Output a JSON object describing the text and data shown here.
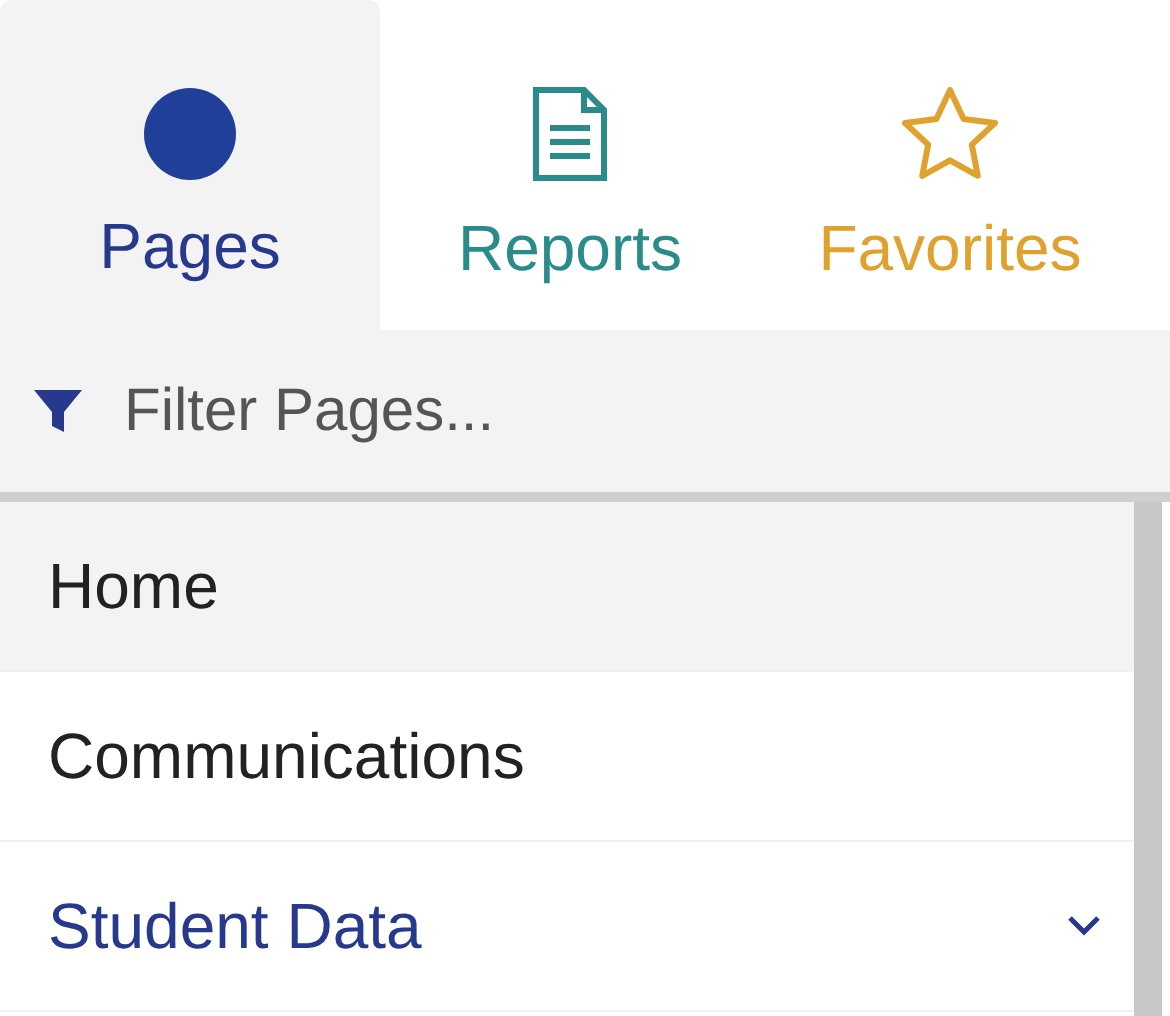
{
  "tabs": [
    {
      "label": "Pages",
      "kind": "circle",
      "selected": true
    },
    {
      "label": "Reports",
      "kind": "document",
      "selected": false
    },
    {
      "label": "Favorites",
      "kind": "star",
      "selected": false
    }
  ],
  "filter": {
    "placeholder": "Filter Pages..."
  },
  "pages": [
    {
      "label": "Home",
      "kind": "page",
      "selected": true
    },
    {
      "label": "Communications",
      "kind": "page",
      "selected": false
    },
    {
      "label": "Student Data",
      "kind": "group",
      "expanded": false,
      "selected": false
    }
  ]
}
